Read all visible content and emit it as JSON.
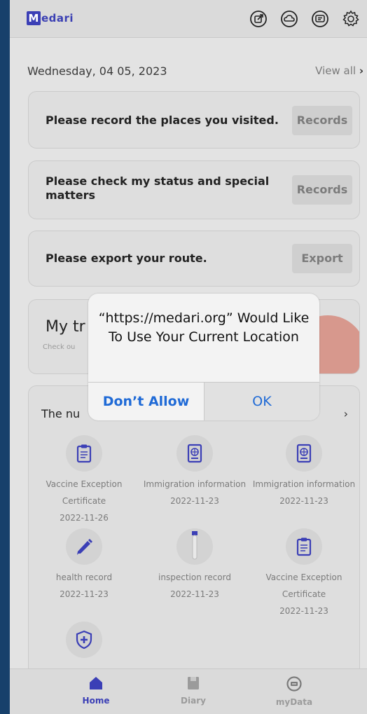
{
  "app": {
    "logo_mark": "M",
    "logo_text": "edari"
  },
  "header_icons": [
    "export-icon",
    "cloud-icon",
    "chat-icon",
    "gear-icon"
  ],
  "main": {
    "date": "Wednesday, 04 05, 2023",
    "view_all": "View all",
    "view_all_chevron": "›",
    "cards": [
      {
        "label": "Please record the places you visited.",
        "button": "Records"
      },
      {
        "label": "Please check my status and special matters",
        "button": "Records"
      },
      {
        "label": "Please export your route.",
        "button": "Export"
      }
    ],
    "trip": {
      "title": "My tr",
      "subtitle": "Check ou"
    },
    "list": {
      "title": "The nu",
      "chevron": "›",
      "items": [
        {
          "icon": "clipboard-icon",
          "name": "Vaccine Exception Certificate",
          "date": "2022-11-26"
        },
        {
          "icon": "passport-icon",
          "name": "Immigration information",
          "date": "2022-11-23"
        },
        {
          "icon": "passport-icon",
          "name": "Immigration information",
          "date": "2022-11-23"
        },
        {
          "icon": "pencil-icon",
          "name": "health record",
          "date": "2022-11-23"
        },
        {
          "icon": "test-tube-icon",
          "name": "inspection record",
          "date": "2022-11-23"
        },
        {
          "icon": "clipboard-icon",
          "name": "Vaccine Exception Certificate",
          "date": "2022-11-23"
        },
        {
          "icon": "shield-plus-icon",
          "name": "",
          "date": ""
        }
      ]
    }
  },
  "dialog": {
    "message": "“https://medari.org” Would Like To Use Your Current Location",
    "deny": "Don’t Allow",
    "ok": "OK"
  },
  "bottom_nav": [
    {
      "label": "Home",
      "icon": "home-icon",
      "active": true
    },
    {
      "label": "Diary",
      "icon": "diary-icon",
      "active": false
    },
    {
      "label": "myData",
      "icon": "mydata-icon",
      "active": false
    }
  ],
  "colors": {
    "brand": "#3b3fb6",
    "accent_blue": "#1f6ad6",
    "background": "#17406b"
  }
}
